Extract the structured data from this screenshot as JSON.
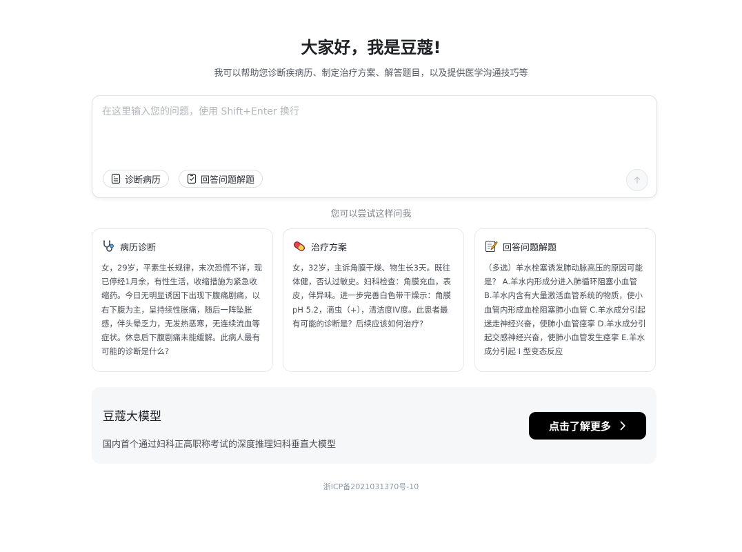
{
  "hero": {
    "title": "大家好，我是豆蔻!",
    "subtitle": "我可以帮助您诊断疾病历、制定治疗方案、解答题目，以及提供医学沟通技巧等"
  },
  "composer": {
    "placeholder": "在这里输入您的问题，使用 Shift+Enter 换行",
    "value": "",
    "chips": [
      {
        "label": "诊断病历",
        "icon": "document-list-icon"
      },
      {
        "label": "回答问题解题",
        "icon": "checklist-icon"
      }
    ],
    "send_icon": "arrow-up-icon"
  },
  "suggestions": {
    "hint": "您可以尝试这样问我",
    "cards": [
      {
        "title": "病历诊断",
        "icon": "stethoscope-icon",
        "body": "女，29岁，平素生长规律，末次恐慌不详，现已停经1月余，有性生活，收缩措施为紧急收缩药。今日无明显诱因下出现下腹痛剧痛，以右下腹为主，呈持续性胀痛，随后一阵坠胀感，伴头晕乏力，无发热恶寒，无连续流血等症状。休息后下腹剧痛未能缓解。此病人最有可能的诊断是什么?"
      },
      {
        "title": "治疗方案",
        "icon": "pill-icon",
        "body": "女，32岁，主诉角膜干燥、物生长3天。既往体健，否认过敏史。妇科检查：角膜充血，表皮，伴异味。进一步完善白色带干燥示：角膜pH 5.2，滴虫（+），清洁度IV度。此患者最有可能的诊断是？后续应该如何治疗?"
      },
      {
        "title": "回答问题解题",
        "icon": "memo-icon",
        "body": "（多选）羊水栓塞诱发肺动脉高压的原因可能是？ A.羊水内形成分进入肺循环阻塞小血管 B.羊水内含有大量激活血管系统的物质，使小血管内形成血栓阻塞肺小血管 C.羊水成分引起迷走神经兴奋，使肺小血管痉挛 D.羊水成分引起交感神经兴奋，使肺小血管发生痉挛 E.羊水成分引起 I 型变态反应"
      }
    ]
  },
  "promo": {
    "title": "豆蔻大模型",
    "description": "国内首个通过妇科正高职称考试的深度推理妇科垂直大模型",
    "button_label": "点击了解更多",
    "button_icon": "chevron-right-icon"
  },
  "footer": {
    "icp": "浙ICP备2021031370号-10"
  },
  "colors": {
    "primary_button": "#000000",
    "promo_background": "#f6f7f8",
    "icp_link": "#8a99ab"
  }
}
